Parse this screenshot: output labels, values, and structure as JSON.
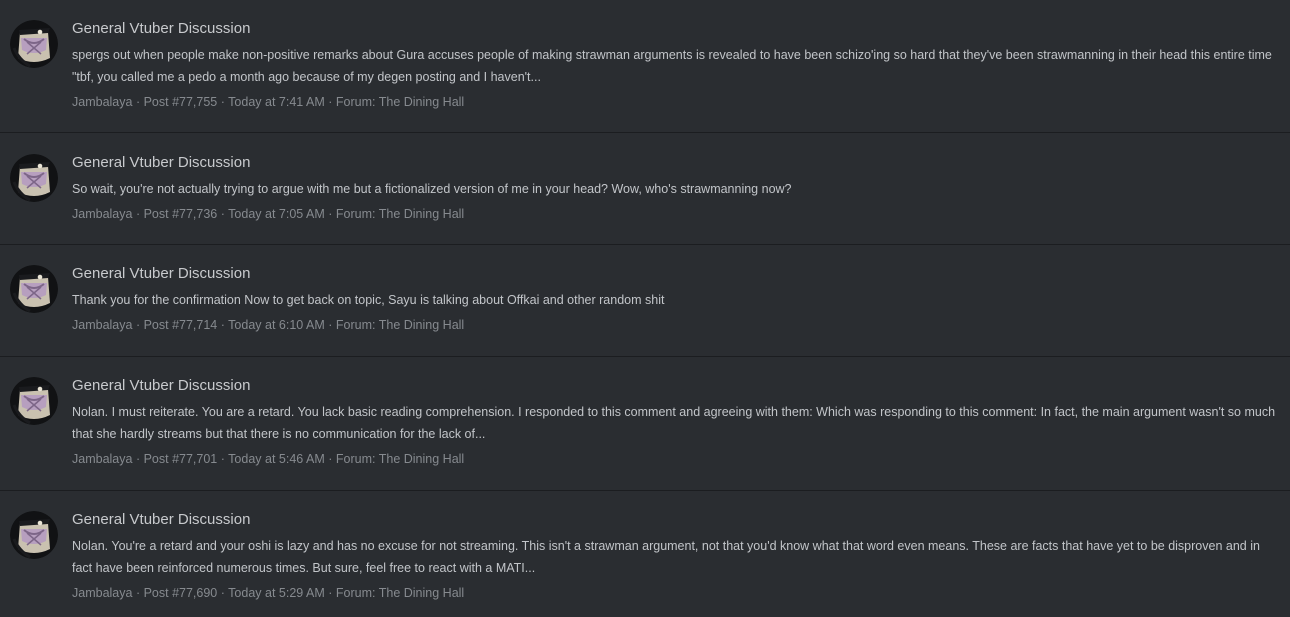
{
  "separator": "·",
  "results": [
    {
      "title": "General Vtuber Discussion",
      "snippet": "spergs out when people make non-positive remarks about Gura accuses people of making strawman arguments is revealed to have been schizo'ing so hard that they've been strawmanning in their head this entire time \"tbf, you called me a pedo a month ago because of my degen posting and I haven't...",
      "author": "Jambalaya",
      "post": "Post #77,755",
      "time": "Today at 7:41 AM",
      "forum": "Forum: The Dining Hall"
    },
    {
      "title": "General Vtuber Discussion",
      "snippet": "So wait, you're not actually trying to argue with me but a fictionalized version of me in your head? Wow, who's strawmanning now?",
      "author": "Jambalaya",
      "post": "Post #77,736",
      "time": "Today at 7:05 AM",
      "forum": "Forum: The Dining Hall"
    },
    {
      "title": "General Vtuber Discussion",
      "snippet": "Thank you for the confirmation Now to get back on topic, Sayu is talking about Offkai and other random shit",
      "author": "Jambalaya",
      "post": "Post #77,714",
      "time": "Today at 6:10 AM",
      "forum": "Forum: The Dining Hall"
    },
    {
      "title": "General Vtuber Discussion",
      "snippet": "Nolan. I must reiterate. You are a retard. You lack basic reading comprehension. I responded to this comment and agreeing with them: Which was responding to this comment: In fact, the main argument wasn't so much that she hardly streams but that there is no communication for the lack of...",
      "author": "Jambalaya",
      "post": "Post #77,701",
      "time": "Today at 5:46 AM",
      "forum": "Forum: The Dining Hall"
    },
    {
      "title": "General Vtuber Discussion",
      "snippet": "Nolan. You're a retard and your oshi is lazy and has no excuse for not streaming. This isn't a strawman argument, not that you'd know what that word even means. These are facts that have yet to be disproven and in fact have been reinforced numerous times. But sure, feel free to react with a MATI...",
      "author": "Jambalaya",
      "post": "Post #77,690",
      "time": "Today at 5:29 AM",
      "forum": "Forum: The Dining Hall"
    }
  ]
}
